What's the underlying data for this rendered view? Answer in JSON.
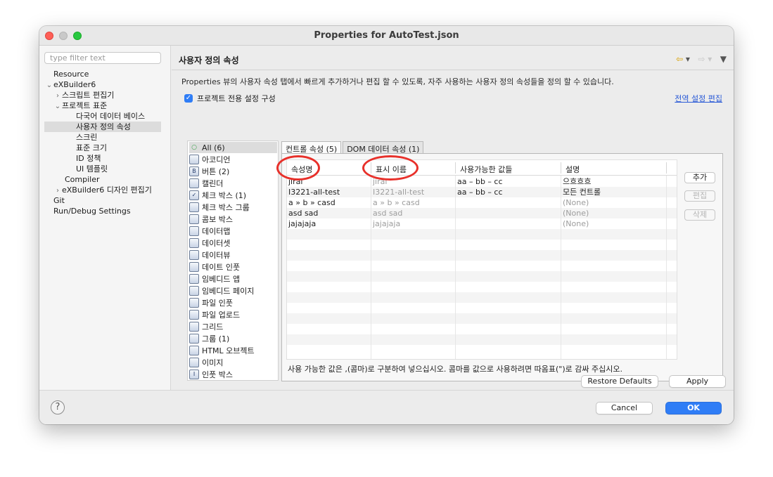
{
  "window": {
    "title": "Properties for AutoTest.json"
  },
  "filter": {
    "placeholder": "type filter text"
  },
  "tree": [
    {
      "label": "Resource",
      "chevron": ""
    },
    {
      "label": "eXBuilder6",
      "chevron": "⌄"
    },
    {
      "label": "스크립트 편집기",
      "chevron": "›"
    },
    {
      "label": "프로젝트 표준",
      "chevron": "⌄"
    },
    {
      "label": "다국어 데이터 베이스",
      "chevron": ""
    },
    {
      "label": "사용자 정의 속성",
      "chevron": ""
    },
    {
      "label": "스크린",
      "chevron": ""
    },
    {
      "label": "표준 크기",
      "chevron": ""
    },
    {
      "label": "ID 정책",
      "chevron": ""
    },
    {
      "label": "UI 템플릿",
      "chevron": ""
    },
    {
      "label": "Compiler",
      "chevron": ""
    },
    {
      "label": "eXBuilder6 디자인 편집기",
      "chevron": "›"
    },
    {
      "label": "Git",
      "chevron": ""
    },
    {
      "label": "Run/Debug Settings",
      "chevron": ""
    }
  ],
  "page": {
    "title": "사용자 정의 속성",
    "description": "Properties 뷰의 사용자 속성 탭에서 빠르게 추가하거나 편집 할 수 있도록, 자주 사용하는 사용자 정의 속성들을 정의 할 수 있습니다.",
    "project_checkbox_label": "프로젝트 전용 설정 구성",
    "global_link": "전역 설정 편집",
    "nav": {
      "back": "⇦",
      "forward": "⇨",
      "dropdown": "▾",
      "menu": "▼"
    }
  },
  "palette": [
    {
      "label": "All (6)",
      "icon": "bullet-icon"
    },
    {
      "label": "아코디언",
      "icon": "accordion-icon"
    },
    {
      "label": "버튼 (2)",
      "icon": "button-icon",
      "glyph": "B"
    },
    {
      "label": "캘린더",
      "icon": "calendar-icon"
    },
    {
      "label": "체크 박스 (1)",
      "icon": "checkbox-icon",
      "glyph": "✓"
    },
    {
      "label": "체크 박스 그룹",
      "icon": "checkbox-group-icon"
    },
    {
      "label": "콤보 박스",
      "icon": "combobox-icon"
    },
    {
      "label": "데이터맵",
      "icon": "datamap-icon"
    },
    {
      "label": "데이터셋",
      "icon": "dataset-icon"
    },
    {
      "label": "데이터뷰",
      "icon": "dataview-icon"
    },
    {
      "label": "데이트 인풋",
      "icon": "dateinput-icon"
    },
    {
      "label": "임베디드 앱",
      "icon": "embedded-app-icon"
    },
    {
      "label": "임베디드 페이지",
      "icon": "embedded-page-icon"
    },
    {
      "label": "파일 인풋",
      "icon": "fileinput-icon"
    },
    {
      "label": "파일 업로드",
      "icon": "fileupload-icon"
    },
    {
      "label": "그리드",
      "icon": "grid-icon"
    },
    {
      "label": "그룹 (1)",
      "icon": "group-icon"
    },
    {
      "label": "HTML 오브젝트",
      "icon": "html-object-icon"
    },
    {
      "label": "이미지",
      "icon": "image-icon"
    },
    {
      "label": "인풋 박스",
      "icon": "inputbox-icon",
      "glyph": "I"
    }
  ],
  "tabs": [
    {
      "label": "컨트롤 속성 (5)"
    },
    {
      "label": "DOM 데이터 속성 (1)"
    }
  ],
  "table": {
    "headers": [
      "속성명",
      "표시 이름",
      "사용가능한 값들",
      "설명"
    ],
    "rows": [
      [
        "jirai",
        "jirai",
        "aa – bb – cc",
        "으흐흐흐"
      ],
      [
        "I3221-all-test",
        "I3221-all-test",
        "aa – bb – cc",
        "모든 컨트롤"
      ],
      [
        "a » b » casd",
        "a » b » casd",
        "",
        "(None)"
      ],
      [
        "asd sad",
        "asd sad",
        "",
        "(None)"
      ],
      [
        "jajajaja",
        "jajajaja",
        "",
        "(None)"
      ]
    ]
  },
  "side_buttons": {
    "add": "추가",
    "edit": "편집",
    "delete": "삭제"
  },
  "hint": "사용 가능한 값은 ,(콤마)로 구분하여 넣으십시오. 콤마를 값으로 사용하려면 따옴표(\")로 감싸 주십시오.",
  "buttons": {
    "restore": "Restore Defaults",
    "apply": "Apply",
    "cancel": "Cancel",
    "ok": "OK",
    "help": "?"
  },
  "colors": {
    "accent": "#2f7df6",
    "link": "#2859d6",
    "annotation": "#e8302a"
  }
}
